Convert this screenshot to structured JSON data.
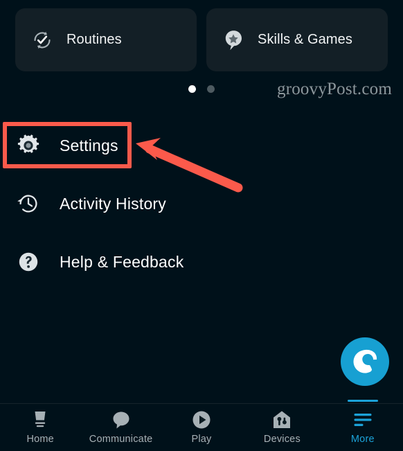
{
  "app": {
    "background_color": "#00111a",
    "card_color": "#131f26",
    "accent_color": "#1ba2d8",
    "annotation_color": "#fb5a4b"
  },
  "carousel": {
    "cards": [
      {
        "label": "Routines",
        "icon": "routines-refresh-check-icon"
      },
      {
        "label": "Skills & Games",
        "icon": "skills-star-pin-icon"
      }
    ],
    "pager": {
      "total": 2,
      "active_index": 0
    }
  },
  "watermark": {
    "text": "groovyPost.com"
  },
  "menu": {
    "items": [
      {
        "label": "Settings",
        "icon": "gear-icon",
        "highlighted": true
      },
      {
        "label": "Activity History",
        "icon": "clock-history-icon",
        "highlighted": false
      },
      {
        "label": "Help & Feedback",
        "icon": "question-circle-icon",
        "highlighted": false
      }
    ]
  },
  "annotation": {
    "highlight_target": "Settings",
    "arrow": {
      "points_to": "Settings",
      "color": "#fb5a4b"
    }
  },
  "alexa_button": {
    "label": "Alexa",
    "icon": "alexa-ring-icon",
    "color": "#17a0d2"
  },
  "bottom_nav": {
    "items": [
      {
        "label": "Home",
        "icon": "echo-device-icon",
        "active": false
      },
      {
        "label": "Communicate",
        "icon": "speech-bubble-icon",
        "active": false
      },
      {
        "label": "Play",
        "icon": "play-circle-icon",
        "active": false
      },
      {
        "label": "Devices",
        "icon": "home-devices-icon",
        "active": false
      },
      {
        "label": "More",
        "icon": "more-lines-icon",
        "active": true
      }
    ]
  }
}
